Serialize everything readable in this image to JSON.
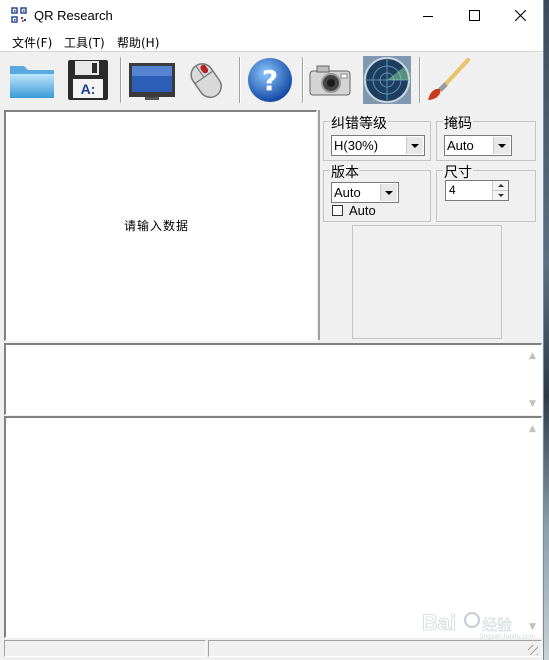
{
  "window": {
    "title": "QR Research",
    "controls": [
      "minimize",
      "maximize",
      "close"
    ]
  },
  "menu": [
    {
      "label": "文件(F)"
    },
    {
      "label": "工具(T)"
    },
    {
      "label": "帮助(H)"
    }
  ],
  "toolbar": {
    "buttons": [
      "open-folder-icon",
      "save-disk-icon",
      "monitor-icon",
      "mouse-icon",
      "help-icon",
      "camera-icon",
      "radar-icon",
      "brush-icon"
    ]
  },
  "input": {
    "placeholder": "请输入数据"
  },
  "options": {
    "ecc": {
      "label": "纠错等级",
      "value": "H(30%)"
    },
    "mask": {
      "label": "掩码",
      "value": "Auto"
    },
    "version": {
      "label": "版本",
      "value": "Auto",
      "checkbox_label": "Auto",
      "checked": false
    },
    "size": {
      "label": "尺寸",
      "value": "4"
    }
  },
  "watermark": {
    "text": "Baidu经验"
  },
  "colors": {
    "accent": "#0b57c4",
    "window_bg": "#f0f0f0"
  }
}
